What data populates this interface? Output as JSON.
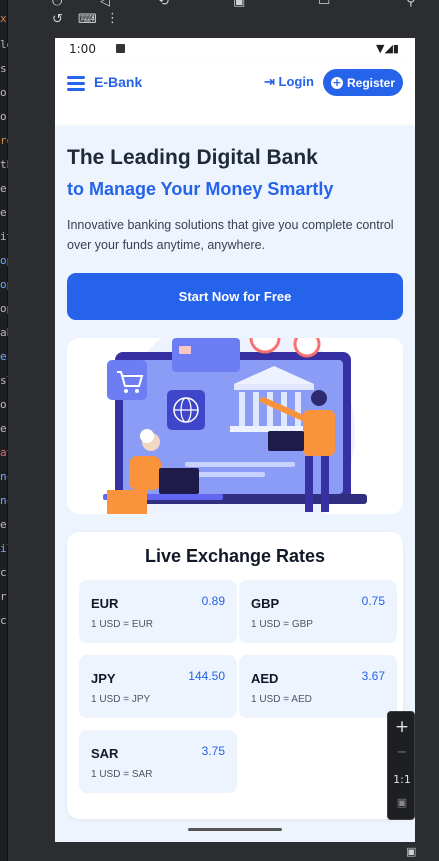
{
  "ide": {
    "gutter_chars": [
      "x",
      "le",
      "s",
      "or",
      "or",
      "ro",
      "th",
      "er",
      "er",
      "it",
      "op",
      "op",
      "op",
      "ab",
      "es",
      "sl",
      "o",
      "e",
      "at",
      "nc",
      "nc",
      "e",
      "il",
      "c",
      "r",
      "c"
    ]
  },
  "status_bar": {
    "time": "1:00",
    "icons": "▼◢▮"
  },
  "app_bar": {
    "brand": "E-Bank",
    "login_label": "Login",
    "register_label": "Register"
  },
  "hero": {
    "title": "The Leading Digital Bank",
    "subtitle": "to Manage Your Money Smartly",
    "description": "Innovative banking solutions that give you complete control over your funds anytime, anywhere.",
    "cta_label": "Start Now for Free"
  },
  "rates": {
    "title": "Live Exchange Rates",
    "items": [
      {
        "code": "EUR",
        "value": "0.89",
        "desc": "1 USD = EUR"
      },
      {
        "code": "GBP",
        "value": "0.75",
        "desc": "1 USD = GBP"
      },
      {
        "code": "JPY",
        "value": "144.50",
        "desc": "1 USD = JPY"
      },
      {
        "code": "AED",
        "value": "3.67",
        "desc": "1 USD = AED"
      },
      {
        "code": "SAR",
        "value": "3.75",
        "desc": "1 USD = SAR"
      }
    ]
  },
  "zoom_panel": {
    "plus": "+",
    "minus": "−",
    "ratio": "1:1"
  },
  "colors": {
    "primary": "#2563eb",
    "hero_bg": "#eef4fe"
  }
}
